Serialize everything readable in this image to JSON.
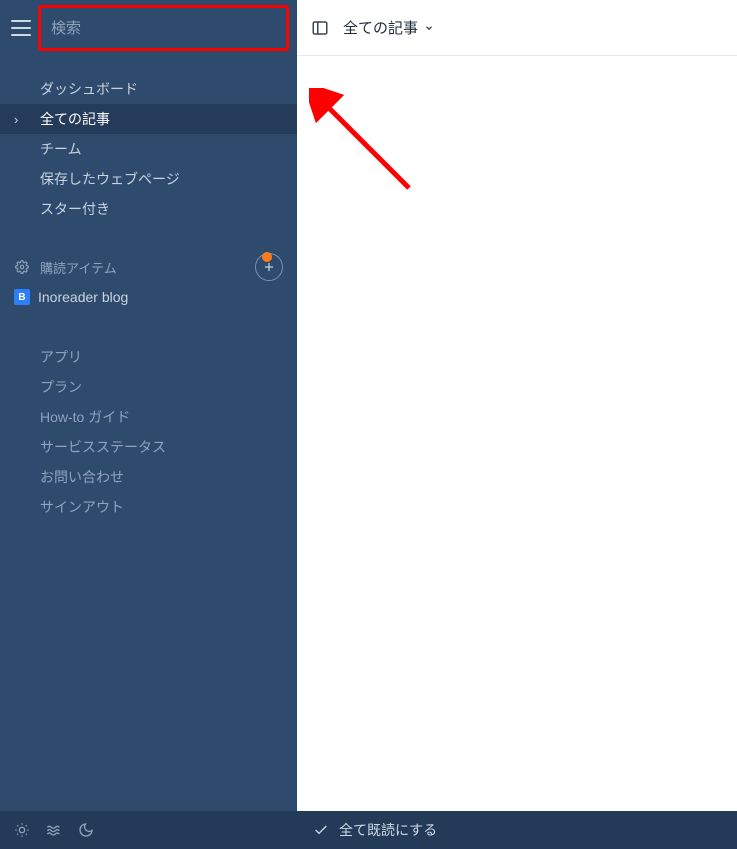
{
  "sidebar": {
    "search_placeholder": "検索",
    "nav": [
      {
        "label": "ダッシュボード",
        "active": false
      },
      {
        "label": "全ての記事",
        "active": true
      },
      {
        "label": "チーム",
        "active": false
      },
      {
        "label": "保存したウェブページ",
        "active": false
      },
      {
        "label": "スター付き",
        "active": false
      }
    ],
    "subscriptions_title": "購読アイテム",
    "feeds": [
      {
        "badge": "B",
        "label": "Inoreader blog"
      }
    ],
    "secondary": [
      {
        "label": "アプリ"
      },
      {
        "label": "プラン"
      },
      {
        "label": "How-to ガイド"
      },
      {
        "label": "サービスステータス"
      },
      {
        "label": "お問い合わせ"
      },
      {
        "label": "サインアウト"
      }
    ]
  },
  "main": {
    "header_title": "全ての記事",
    "footer_mark_read": "全て既読にする"
  }
}
